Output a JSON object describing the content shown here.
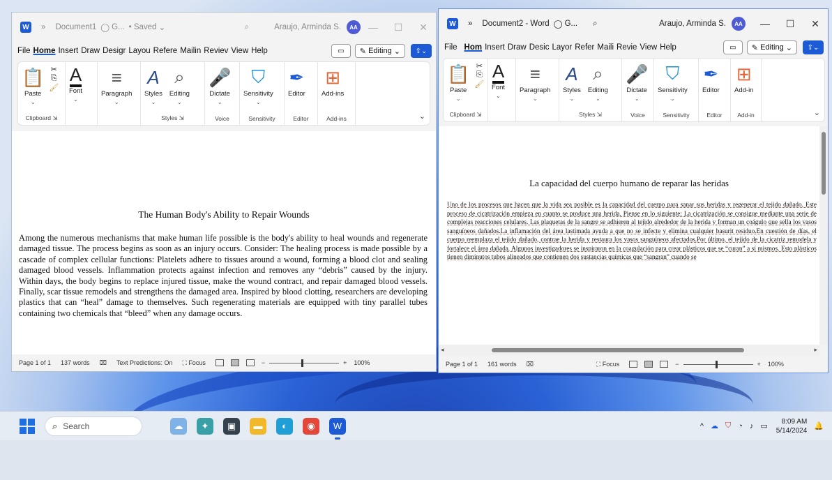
{
  "left_window": {
    "title": {
      "doc_name": "Document1",
      "tab_glyph": "G...",
      "saved": "• Saved",
      "user": "Araujo, Arminda S.",
      "initials": "AA"
    },
    "menu": [
      "File",
      "Home",
      "Insert",
      "Draw",
      "Design",
      "Layout",
      "References",
      "Mailings",
      "Review",
      "View",
      "Help"
    ],
    "menu_display": [
      "File",
      "Home",
      "Insert",
      "Draw",
      "Desigr",
      "Layou",
      "Refere",
      "Mailin",
      "Reviev",
      "View",
      "Help"
    ],
    "editing_label": "Editing",
    "ribbon": {
      "paste": "Paste",
      "font": "Font",
      "paragraph": "Paragraph",
      "styles": "Styles",
      "editing": "Editing",
      "dictate": "Dictate",
      "sensitivity": "Sensitivity",
      "editor": "Editor",
      "addins": "Add-ins",
      "group_clipboard": "Clipboard",
      "group_styles": "Styles",
      "group_voice": "Voice",
      "group_sensitivity": "Sensitivity",
      "group_editor": "Editor",
      "group_addins": "Add-ins"
    },
    "doc_title": "The Human Body's Ability to Repair Wounds",
    "doc_body": "Among the numerous mechanisms that make human life possible is the body's ability to heal wounds and regenerate damaged tissue. The process begins as soon as an injury occurs. Consider: The healing process is made possible by a cascade of complex cellular functions: Platelets adhere to tissues around a wound, forming a blood clot and sealing damaged blood vessels. Inflammation protects against infection and removes any “debris” caused by the injury. Within days, the body begins to replace injured tissue, make the wound contract, and repair damaged blood vessels. Finally, scar tissue remodels and strengthens the damaged area. Inspired by blood clotting, researchers are developing plastics that can “heal” damage to themselves. Such regenerating materials are equipped with tiny parallel tubes containing two chemicals that “bleed” when any damage occurs.",
    "status": {
      "page": "Page 1 of 1",
      "words": "137 words",
      "predictions": "Text Predictions: On",
      "focus": "Focus",
      "zoom": "100%"
    }
  },
  "right_window": {
    "title": {
      "doc_name": "Document2 - Word",
      "tab_glyph": "G...",
      "user": "Araujo, Arminda S.",
      "initials": "AA"
    },
    "menu_display": [
      "File",
      "Hom",
      "Insert",
      "Draw",
      "Desic",
      "Layor",
      "Refer",
      "Maili",
      "Revie",
      "View",
      "Help"
    ],
    "editing_label": "Editing",
    "ribbon": {
      "paste": "Paste",
      "font": "Font",
      "paragraph": "Paragraph",
      "styles": "Styles",
      "editing": "Editing",
      "dictate": "Dictate",
      "sensitivity": "Sensitivity",
      "editor": "Editor",
      "addins": "Add-in",
      "group_clipboard": "Clipboard",
      "group_styles": "Styles",
      "group_voice": "Voice",
      "group_sensitivity": "Sensitivity",
      "group_editor": "Editor",
      "group_addins": "Add-in"
    },
    "doc_title": "La capacidad del cuerpo humano de reparar las heridas",
    "doc_body": "Uno de los procesos que hacen que la vida sea posible es la capacidad del cuerpo para sanar sus heridas y regenerar el tejido dañado. Este proceso de cicatrización empieza en cuanto se produce una herida. Piense en lo siguiente: La cicatrización se consigue mediante una serie de complejas reacciones celulares. Las plaquetas de la sangre se adhieren al tejido alrededor de la herida y forman un coágulo que sella los vasos sanguíneos dañados.La inflamación del área lastimada ayuda a que no se infecte y elimina cualquier basurit residuo.En cuestión de días, el cuerpo reemplaza el tejido dañado, contrae la herida y restaura los vasos sanguíneos afectados.Por último, el tejido de la cicatriz remodela y fortalece el área dañada. Algunos investigadores se inspiraron en la coagulación para crear plásticos que se “curan” a sí mismos. Esto plásticos tienen diminutos tubos alineados que contienen dos sustancias químicas que “sangran” cuando se",
    "status": {
      "page": "Page 1 of 1",
      "words": "161 words",
      "focus": "Focus",
      "zoom": "100%"
    }
  },
  "taskbar": {
    "search_placeholder": "Search",
    "time": "8:09 AM",
    "date": "5/14/2024"
  },
  "colors": {
    "word_blue": "#1d5bd6",
    "avatar": "#4f5bd5",
    "spell_underline": "#c0392b"
  }
}
